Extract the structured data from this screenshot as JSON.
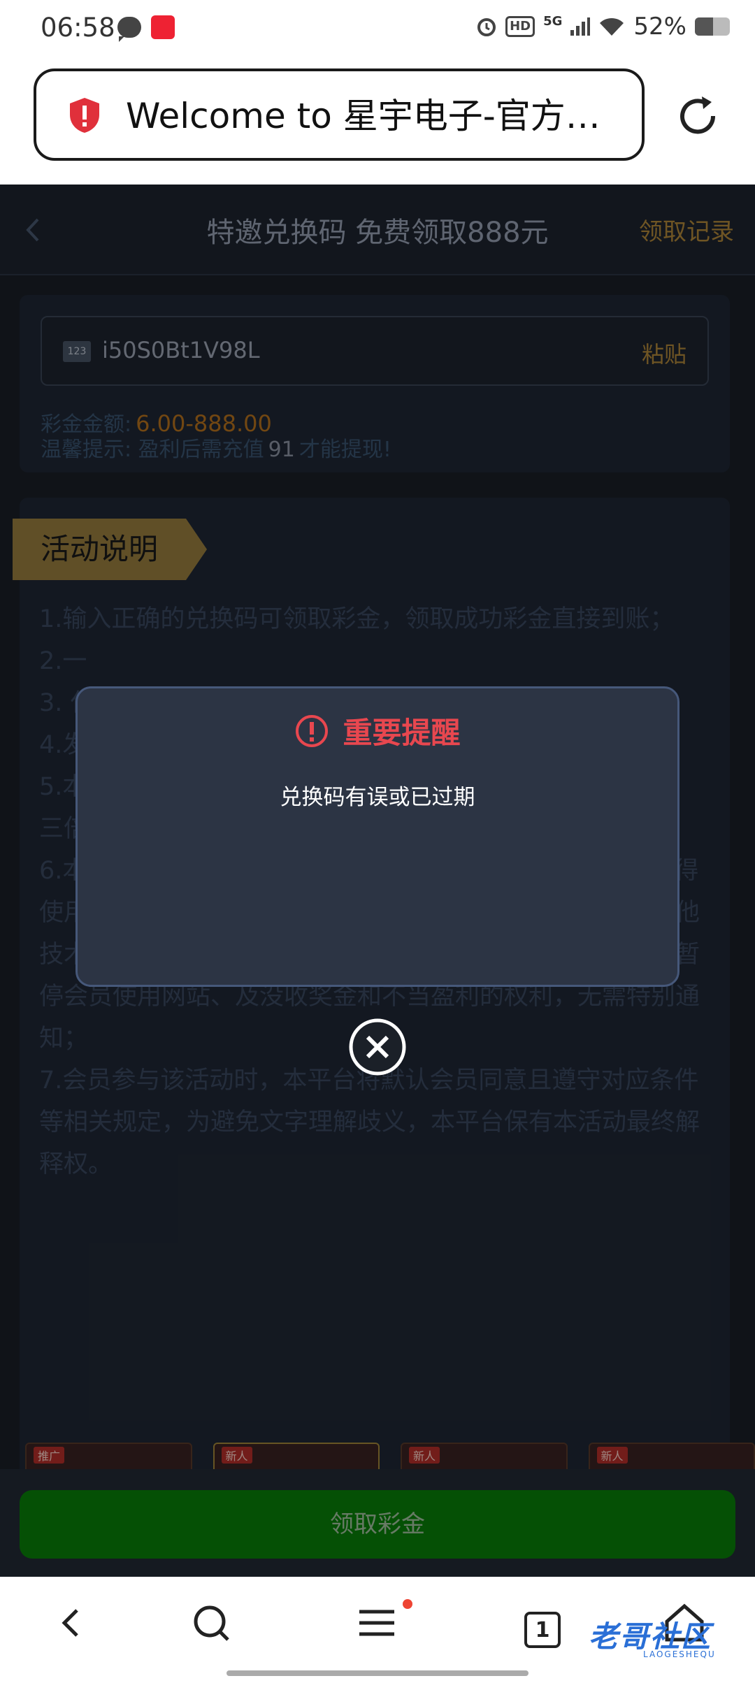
{
  "status_bar": {
    "time": "06:58",
    "network": "5G",
    "hd": "HD",
    "battery": "52%",
    "battery_level": 0.52
  },
  "browser": {
    "url_text": "Welcome to 星宇电子-官方…"
  },
  "header": {
    "title": "特邀兑换码 免费领取888元",
    "record_link": "领取记录"
  },
  "redeem": {
    "code_icon_text": "123",
    "code_value": "i50S0Bt1V98L",
    "paste_label": "粘贴",
    "amount_label": "彩金金额:",
    "amount_range": "6.00-888.00",
    "tip_prefix": "温馨提示: 盈利后需充值",
    "tip_number": "91",
    "tip_suffix": "才能提现!"
  },
  "activity": {
    "section_title": "活动说明",
    "rules": [
      "1.输入正确的兑换码可领取彩金，领取成功彩金直接到账；",
      "2.一",
      "3. 仅                                                                    订类流                                                                    彩金扣",
      "4.发                                                                    将会失",
      "5.本                                                                    盈利达到100元，则需充值相应盈利金额，需完成存款三倍流水即可申请提款；",
      "6.本活动仅限账号本人进行兑换码兑换，禁止租借账号，不得使用外挂程式、机器人、利用协议、漏洞、接口、群控或其他技术手段参与，一经查核属实，本平台有权终止会员登录、暂停会员使用网站、及没收奖金和不当盈利的权利，无需特别通知；",
      "7.会员参与该活动时，本平台将默认会员同意且遵守对应条件等相关规定，为避免文字理解歧义，本平台保有本活动最终解释权。"
    ]
  },
  "promos": [
    {
      "tag": "推广"
    },
    {
      "tag": "新人"
    },
    {
      "tag": "新人"
    },
    {
      "tag": "新人"
    }
  ],
  "claim_button": "领取彩金",
  "modal": {
    "title": "重要提醒",
    "message": "兑换码有误或已过期"
  },
  "navbar": {
    "tab_count": "1",
    "watermark": "老哥社区",
    "watermark_sub": "LAOGESHEQU"
  },
  "colors": {
    "page_bg": "#1b2028",
    "accent_gold": "#b48a3a",
    "claim_green": "#098209",
    "alert_red": "#e8474f"
  }
}
